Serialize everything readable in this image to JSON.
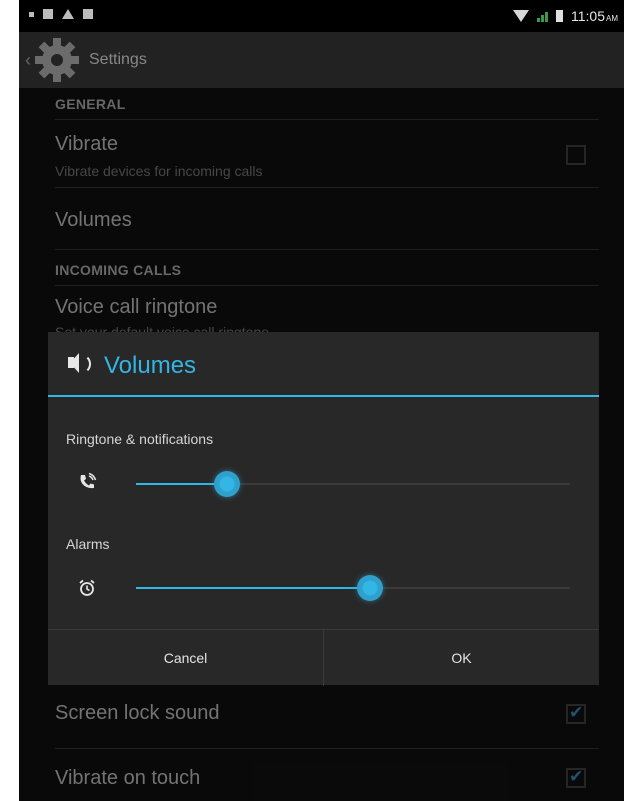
{
  "status_bar": {
    "time": "11:05",
    "ampm": "AM"
  },
  "action_bar": {
    "title": "Settings"
  },
  "settings": {
    "general_header": "GENERAL",
    "vibrate_title": "Vibrate",
    "vibrate_summary": "Vibrate devices for incoming calls",
    "volumes_title": "Volumes",
    "incoming_header": "INCOMING CALLS",
    "ringtone_title": "Voice call ringtone",
    "ringtone_summary": "Set your default voice call ringtone",
    "screen_lock_title": "Screen lock sound",
    "vibrate_touch_title": "Vibrate on touch",
    "vibrate_checked": false,
    "screen_lock_checked": true,
    "vibrate_touch_checked": true
  },
  "dialog": {
    "title": "Volumes",
    "ringtone_label": "Ringtone & notifications",
    "ringtone_level": 0.21,
    "alarms_label": "Alarms",
    "alarms_level": 0.54,
    "cancel_label": "Cancel",
    "ok_label": "OK"
  },
  "colors": {
    "accent": "#33b5e5",
    "background": "#0d0d0d",
    "dialog": "#282828"
  }
}
